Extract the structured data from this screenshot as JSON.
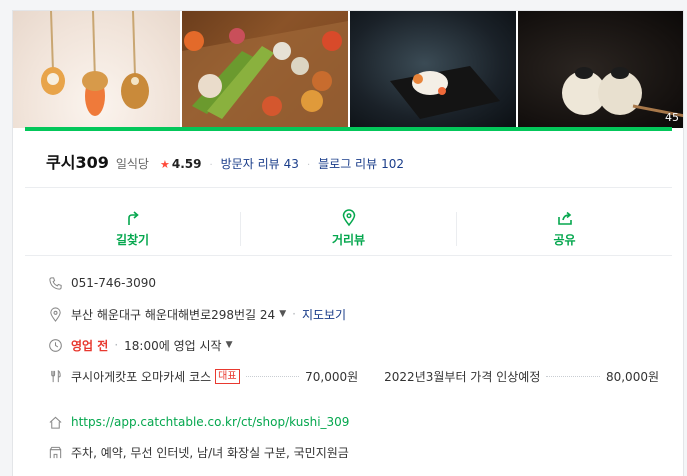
{
  "photos": {
    "count": "45",
    "items": [
      {
        "name": "photo-kushi-skewers"
      },
      {
        "name": "photo-skewer-platter"
      },
      {
        "name": "photo-dish-plate"
      },
      {
        "name": "photo-caviar-balls"
      }
    ]
  },
  "place": {
    "name": "쿠시309",
    "category": "일식당",
    "rating": "4.59",
    "visitor_review_label": "방문자 리뷰",
    "visitor_review_count": "43",
    "blog_review_label": "블로그 리뷰",
    "blog_review_count": "102"
  },
  "actions": {
    "directions": "길찾기",
    "street_view": "거리뷰",
    "share": "공유"
  },
  "info": {
    "phone": "051-746-3090",
    "address": "부산 해운대구 해운대해변로298번길 24",
    "map_link": "지도보기",
    "status": "영업 전",
    "status_detail": "18:00에 영업 시작",
    "menu_name": "쿠시아게캇포 오마카세 코스",
    "menu_badge": "대표",
    "menu_price": "70,000원",
    "menu2_name": "2022년3월부터 가격 인상예정",
    "menu2_price": "80,000원",
    "website": "https://app.catchtable.co.kr/ct/shop/kushi_309",
    "amenities": "주차, 예약, 무선 인터넷, 남/녀 화장실 구분, 국민지원금"
  },
  "colors": {
    "accent_green": "#03c75a",
    "link_blue": "#1a3d8a",
    "closed_red": "#e8392f"
  }
}
